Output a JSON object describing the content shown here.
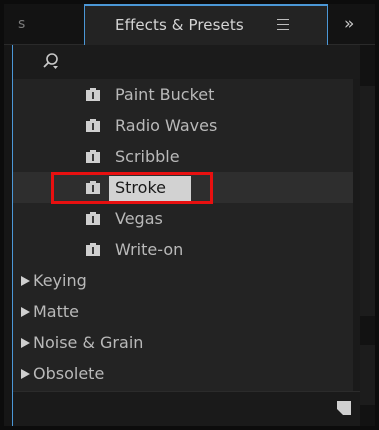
{
  "tabs": {
    "left_partial": "s",
    "active": "Effects & Presets",
    "menu_icon": "hamburger-menu-icon",
    "overflow": "»"
  },
  "search": {
    "icon": "search-dropdown-icon",
    "value": "",
    "placeholder": ""
  },
  "list": {
    "presets": [
      {
        "label": "Paint Bucket"
      },
      {
        "label": "Radio Waves"
      },
      {
        "label": "Scribble"
      },
      {
        "label": "Stroke",
        "selected": true
      },
      {
        "label": "Vegas"
      },
      {
        "label": "Write-on"
      }
    ],
    "categories": [
      {
        "label": "Keying"
      },
      {
        "label": "Matte"
      },
      {
        "label": "Noise & Grain"
      },
      {
        "label": "Obsolete"
      }
    ]
  },
  "colors": {
    "accent": "#4b97d6",
    "highlight": "#e81010"
  },
  "footer": {
    "icon": "new-item-icon"
  }
}
